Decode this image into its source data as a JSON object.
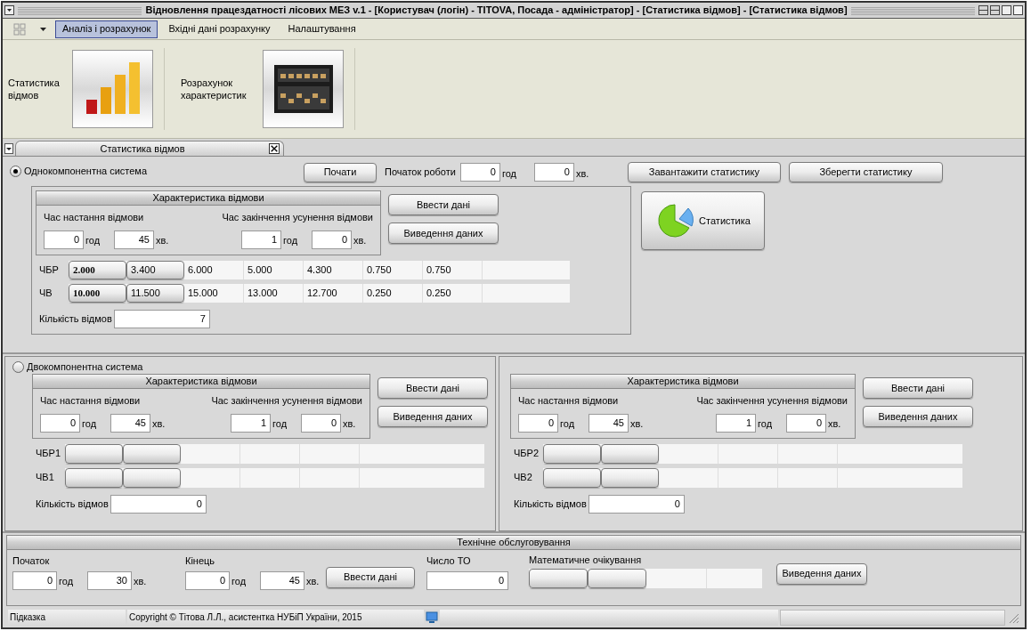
{
  "window": {
    "title": "Відновлення працездатності лісових МЕЗ v.1 - [Користувач (логін) - TITOVA, Посада - адміністратор] - [Статистика відмов] - [Статистика відмов]"
  },
  "menu": {
    "items": [
      {
        "label": "Аналіз і розрахунок",
        "selected": true
      },
      {
        "label": "Вхідні дані розрахунку",
        "selected": false
      },
      {
        "label": "Налаштування",
        "selected": false
      }
    ]
  },
  "ribbon": {
    "groups": [
      {
        "label": "Статистика відмов",
        "kind": "bars"
      },
      {
        "label": "Розрахунок характеристик",
        "kind": "abacus"
      }
    ]
  },
  "doc_tab": {
    "label": "Статистика відмов",
    "selected": true
  },
  "single": {
    "radio": {
      "label": "Однокомпонентна система",
      "selected": true
    },
    "start_button": "Почати",
    "start_label": "Початок роботи",
    "start": [
      {
        "value": "0",
        "unit": "год"
      },
      {
        "value": "0",
        "unit": "хв."
      }
    ],
    "load_button": "Завантажити статистику",
    "save_button": "Зберегти статистику",
    "stats_button": "Статистика",
    "sub": {
      "title": "Характеристика відмови",
      "onset_label": "Час настання відмови",
      "end_label": "Час закінчення усунення відмови",
      "onset": [
        {
          "value": "0",
          "unit": "год"
        },
        {
          "value": "45",
          "unit": "хв."
        }
      ],
      "end": [
        {
          "value": "1",
          "unit": "год"
        },
        {
          "value": "0",
          "unit": "хв."
        }
      ],
      "enter_button": "Ввести дані",
      "output_button": "Виведення даних",
      "rows": [
        {
          "label": "ЧБР",
          "values": [
            "2.000",
            "3.400",
            "6.000",
            "5.000",
            "4.300",
            "0.750",
            "0.750"
          ]
        },
        {
          "label": "ЧВ",
          "values": [
            "10.000",
            "11.500",
            "15.000",
            "13.000",
            "12.700",
            "0.250",
            "0.250"
          ]
        }
      ],
      "count_label": "Кількість відмов",
      "count": "7"
    }
  },
  "double": {
    "radio": {
      "label": "Двокомпонентна система",
      "selected": false
    },
    "subsystems": [
      {
        "title": "Характеристика відмови",
        "onset_label": "Час настання відмови",
        "end_label": "Час закінчення усунення відмови",
        "onset": [
          {
            "value": "0",
            "unit": "год"
          },
          {
            "value": "45",
            "unit": "хв."
          }
        ],
        "end": [
          {
            "value": "1",
            "unit": "год"
          },
          {
            "value": "0",
            "unit": "хв."
          }
        ],
        "enter_button": "Ввести дані",
        "output_button": "Виведення даних",
        "rows": [
          {
            "label": "ЧБР1"
          },
          {
            "label": "ЧВ1"
          }
        ],
        "count_label": "Кількість відмов",
        "count": "0"
      },
      {
        "title": "Характеристика відмови",
        "onset_label": "Час настання відмови",
        "end_label": "Час закінчення усунення відмови",
        "onset": [
          {
            "value": "0",
            "unit": "год"
          },
          {
            "value": "45",
            "unit": "хв."
          }
        ],
        "end": [
          {
            "value": "1",
            "unit": "год"
          },
          {
            "value": "0",
            "unit": "хв."
          }
        ],
        "enter_button": "Ввести дані",
        "output_button": "Виведення даних",
        "rows": [
          {
            "label": "ЧБР2"
          },
          {
            "label": "ЧВ2"
          }
        ],
        "count_label": "Кількість відмов",
        "count": "0"
      }
    ]
  },
  "maintenance": {
    "title": "Технічне обслуговування",
    "start_label": "Початок",
    "start": [
      {
        "value": "0",
        "unit": "год"
      },
      {
        "value": "30",
        "unit": "хв."
      }
    ],
    "end_label": "Кінець",
    "end": [
      {
        "value": "0",
        "unit": "год"
      },
      {
        "value": "45",
        "unit": "хв."
      }
    ],
    "enter_button": "Ввести дані",
    "to_label": "Число ТО",
    "to_value": "0",
    "expectation_label": "Математичне очікування",
    "output_button": "Виведення даних"
  },
  "status_bar": {
    "hint": "Підказка",
    "copyright": "Copyright © Тітова Л.Л., асистентка НУБіП України, 2015"
  }
}
